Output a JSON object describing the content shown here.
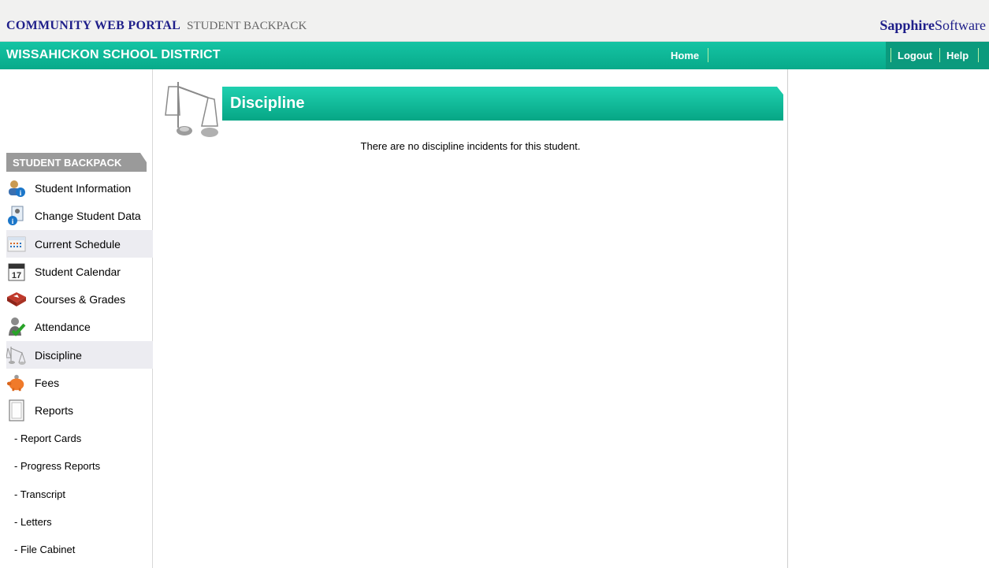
{
  "header": {
    "portal_name": "COMMUNITY WEB PORTAL",
    "portal_sub": "STUDENT BACKPACK",
    "brand_bold": "Sapphire",
    "brand_rest": "Software"
  },
  "navbar": {
    "district": "WISSAHICKON SCHOOL DISTRICT",
    "home": "Home",
    "logout": "Logout",
    "help": "Help"
  },
  "sidebar": {
    "header": "STUDENT BACKPACK",
    "items": [
      {
        "label": "Student Information",
        "icon": "student-info-icon"
      },
      {
        "label": "Change Student Data",
        "icon": "change-data-icon"
      },
      {
        "label": "Current Schedule",
        "icon": "schedule-icon"
      },
      {
        "label": "Student Calendar",
        "icon": "calendar-icon",
        "calendar_day": "17"
      },
      {
        "label": "Courses & Grades",
        "icon": "book-icon"
      },
      {
        "label": "Attendance",
        "icon": "attendance-icon"
      },
      {
        "label": "Discipline",
        "icon": "scales-icon"
      },
      {
        "label": "Fees",
        "icon": "piggy-bank-icon"
      },
      {
        "label": "Reports",
        "icon": "document-icon"
      }
    ],
    "subitems": [
      "- Report Cards",
      "- Progress Reports",
      "- Transcript",
      "- Letters",
      "- File Cabinet"
    ]
  },
  "main": {
    "title": "Discipline",
    "message": "There are no discipline incidents for this student."
  },
  "colors": {
    "teal": "#08aa8a",
    "navy": "#1f1f8a"
  }
}
